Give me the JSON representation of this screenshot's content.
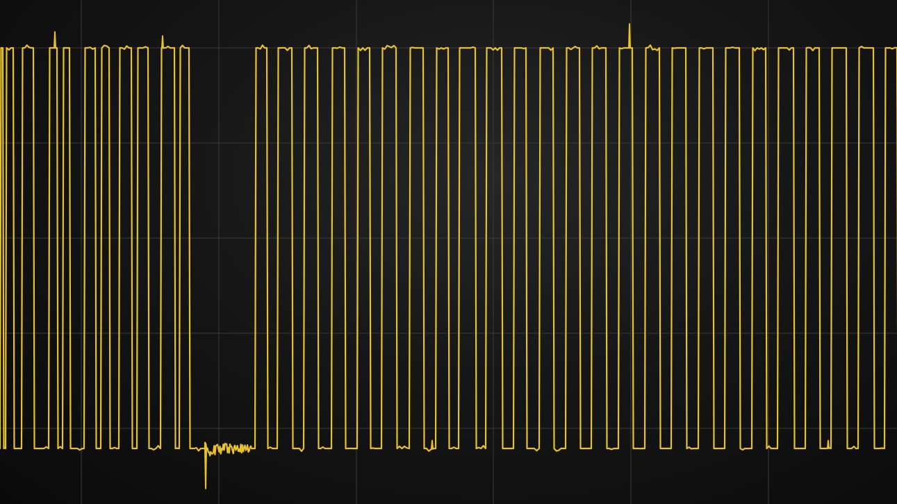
{
  "chart_data": {
    "type": "line",
    "grid": true,
    "grid_divisions": {
      "x": 11,
      "y": 5
    },
    "colors": {
      "trace": "#e8c22a",
      "grid": "#3a3a3a",
      "background": "#0b0b0b"
    },
    "series": [
      {
        "high_level": 1,
        "low_level": 0,
        "pulses": [
          [
            0,
            4
          ],
          [
            8,
            19
          ],
          [
            31,
            48
          ],
          [
            70,
            82
          ],
          [
            90,
            100
          ],
          [
            121,
            137
          ],
          [
            145,
            157
          ],
          [
            171,
            189
          ],
          [
            197,
            213
          ],
          [
            231,
            251
          ],
          [
            258,
            272
          ],
          [
            367,
            384
          ],
          [
            399,
            420
          ],
          [
            437,
            457
          ],
          [
            477,
            496
          ],
          [
            514,
            532
          ],
          [
            549,
            570
          ],
          [
            589,
            609
          ],
          [
            627,
            645
          ],
          [
            660,
            684
          ],
          [
            699,
            722
          ],
          [
            739,
            757
          ],
          [
            776,
            796
          ],
          [
            814,
            834
          ],
          [
            851,
            872
          ],
          [
            890,
            910
          ],
          [
            928,
            949
          ],
          [
            966,
            987
          ],
          [
            1005,
            1026
          ],
          [
            1043,
            1064
          ],
          [
            1082,
            1102
          ],
          [
            1119,
            1142
          ],
          [
            1159,
            1179
          ],
          [
            1196,
            1218
          ],
          [
            1235,
            1257
          ],
          [
            1273,
            1291
          ]
        ],
        "noise_burst": [
          295,
          362
        ],
        "glitches": [
          {
            "x": 79,
            "level": "high",
            "amp": 0.04
          },
          {
            "x": 234,
            "level": "high",
            "amp": 0.03
          },
          {
            "x": 296,
            "level": "low",
            "amp": -0.1
          },
          {
            "x": 906,
            "level": "high",
            "amp": 0.06
          },
          {
            "x": 622,
            "level": "low",
            "amp": 0.02
          },
          {
            "x": 1192,
            "level": "low",
            "amp": 0.02
          }
        ]
      }
    ]
  }
}
